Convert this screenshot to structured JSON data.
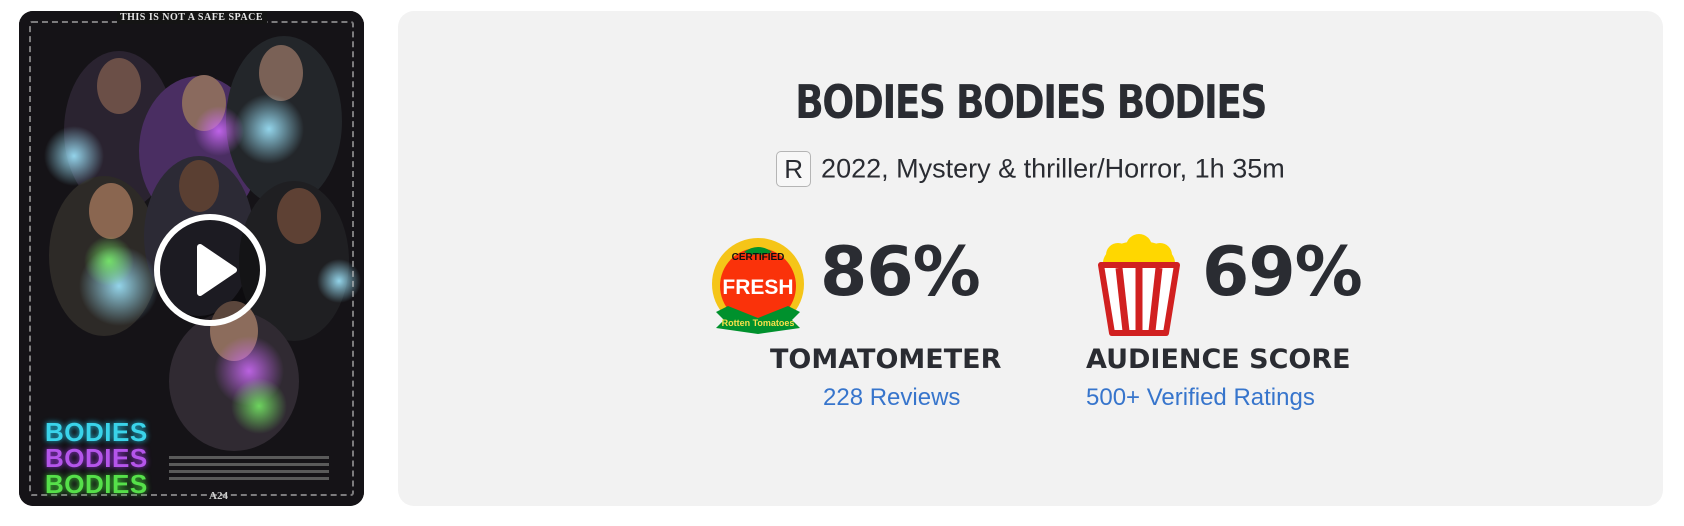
{
  "poster": {
    "tagline": "THIS IS NOT A SAFE SPACE",
    "title_lines": [
      "BODIES",
      "BODIES",
      "BODIES"
    ],
    "studio": "A24",
    "play_icon": "play-icon"
  },
  "movie": {
    "title": "BODIES BODIES BODIES",
    "rating": "R",
    "info": "2022, Mystery & thriller/Horror, 1h 35m"
  },
  "tomatometer": {
    "icon": "certified-fresh-icon",
    "badge_top": "CERTIFIED",
    "badge_middle": "FRESH",
    "badge_bottom": "Rotten Tomatoes",
    "score": "86%",
    "label": "TOMATOMETER",
    "reviews": "228 Reviews"
  },
  "audience": {
    "icon": "popcorn-icon",
    "score": "69%",
    "label": "AUDIENCE SCORE",
    "ratings": "500+ Verified Ratings"
  },
  "colors": {
    "panel_bg": "#f2f2f2",
    "text": "#2a2c32",
    "link": "#3775cc",
    "fresh_red": "#fa320a",
    "popcorn_yellow": "#ffd700"
  }
}
